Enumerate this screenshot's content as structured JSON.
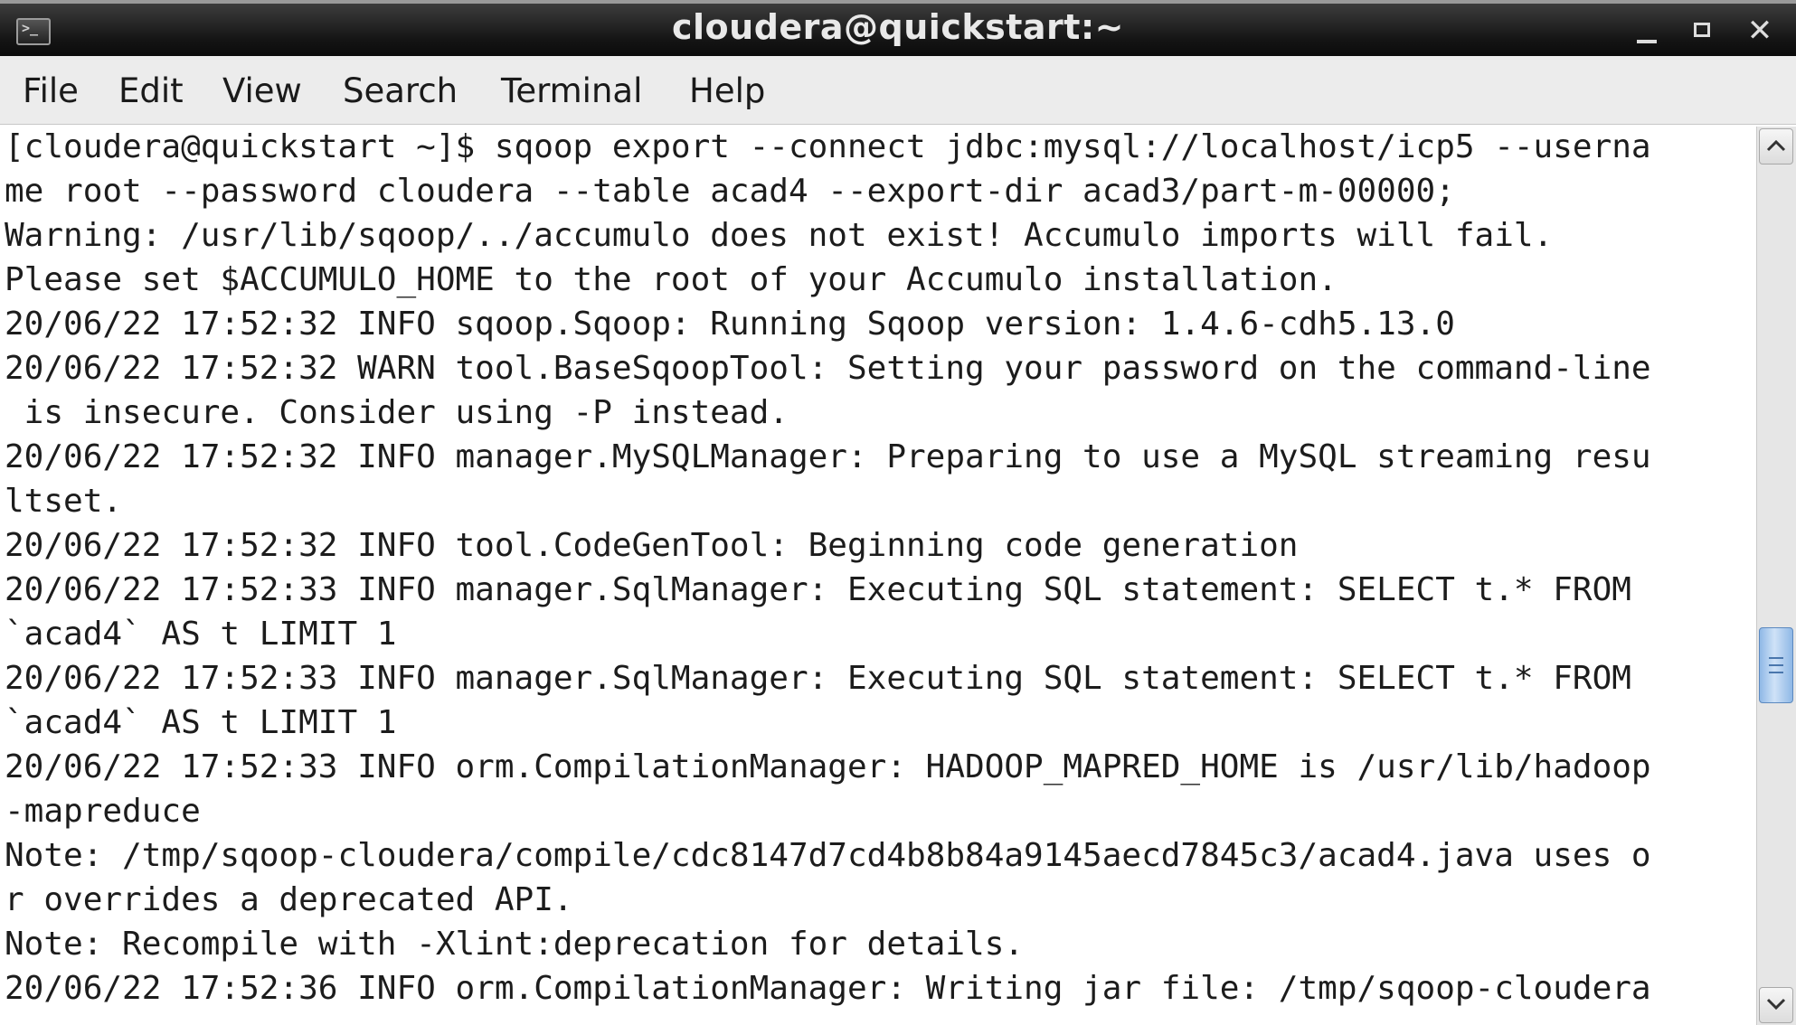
{
  "window": {
    "title": "cloudera@quickstart:~",
    "icon": "terminal-icon",
    "controls": [
      "minimize-icon",
      "maximize-icon",
      "close-icon"
    ],
    "close_label": "✕"
  },
  "menu": {
    "items": [
      "File",
      "Edit",
      "View",
      "Search",
      "Terminal",
      "Help"
    ]
  },
  "terminal": {
    "lines": [
      "[cloudera@quickstart ~]$ sqoop export --connect jdbc:mysql://localhost/icp5 --userna",
      "me root --password cloudera --table acad4 --export-dir acad3/part-m-00000;",
      "Warning: /usr/lib/sqoop/../accumulo does not exist! Accumulo imports will fail.",
      "Please set $ACCUMULO_HOME to the root of your Accumulo installation.",
      "20/06/22 17:52:32 INFO sqoop.Sqoop: Running Sqoop version: 1.4.6-cdh5.13.0",
      "20/06/22 17:52:32 WARN tool.BaseSqoopTool: Setting your password on the command-line",
      " is insecure. Consider using -P instead.",
      "20/06/22 17:52:32 INFO manager.MySQLManager: Preparing to use a MySQL streaming resu",
      "ltset.",
      "20/06/22 17:52:32 INFO tool.CodeGenTool: Beginning code generation",
      "20/06/22 17:52:33 INFO manager.SqlManager: Executing SQL statement: SELECT t.* FROM ",
      "`acad4` AS t LIMIT 1",
      "20/06/22 17:52:33 INFO manager.SqlManager: Executing SQL statement: SELECT t.* FROM ",
      "`acad4` AS t LIMIT 1",
      "20/06/22 17:52:33 INFO orm.CompilationManager: HADOOP_MAPRED_HOME is /usr/lib/hadoop",
      "-mapreduce",
      "Note: /tmp/sqoop-cloudera/compile/cdc8147d7cd4b8b84a9145aecd7845c3/acad4.java uses o",
      "r overrides a deprecated API.",
      "Note: Recompile with -Xlint:deprecation for details.",
      "20/06/22 17:52:36 INFO orm.CompilationManager: Writing jar file: /tmp/sqoop-cloudera"
    ]
  },
  "scrollbar": {
    "position_fraction": 0.6
  }
}
